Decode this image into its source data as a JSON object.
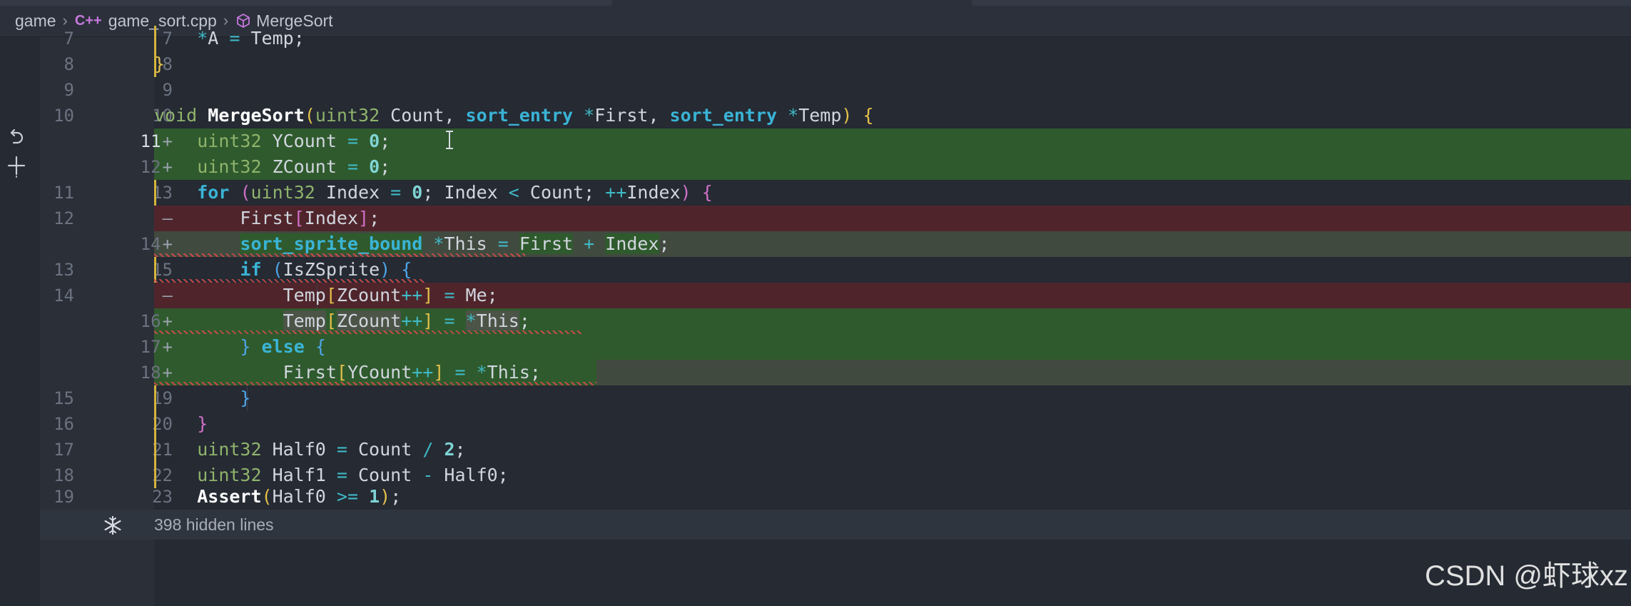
{
  "breadcrumb": {
    "folder": "game",
    "file_icon": "C++",
    "file": "game_sort.cpp",
    "symbol": "MergeSort"
  },
  "editor": {
    "hidden_lines_label": "398 hidden lines",
    "diff_colors": {
      "added": "#2f5a2d",
      "removed": "#4f252b",
      "modified": "#414a3f",
      "edit_bar": "#d4b43c"
    }
  },
  "watermark": "CSDN @虾球xz",
  "lines": [
    {
      "old": "7",
      "new": "7",
      "mark": "",
      "code": "    *A = Temp;"
    },
    {
      "old": "8",
      "new": "8",
      "mark": "",
      "code": "}"
    },
    {
      "old": "9",
      "new": "9",
      "mark": "",
      "code": ""
    },
    {
      "old": "10",
      "new": "10",
      "mark": "",
      "code": "void MergeSort(uint32 Count, sort_entry *First, sort_entry *Temp) {"
    },
    {
      "old": "",
      "new": "11",
      "mark": "+",
      "code": "    uint32 YCount = 0;"
    },
    {
      "old": "",
      "new": "12",
      "mark": "+",
      "code": "    uint32 ZCount = 0;"
    },
    {
      "old": "11",
      "new": "13",
      "mark": "",
      "code": "    for (uint32 Index = 0; Index < Count; ++Index) {"
    },
    {
      "old": "12",
      "new": "",
      "mark": "—",
      "code": "        First[Index];"
    },
    {
      "old": "",
      "new": "14",
      "mark": "+",
      "code": "        sort_sprite_bound *This = First + Index;"
    },
    {
      "old": "13",
      "new": "15",
      "mark": "",
      "code": "        if (IsZSprite) {"
    },
    {
      "old": "14",
      "new": "",
      "mark": "—",
      "code": "            Temp[ZCount++] = Me;"
    },
    {
      "old": "",
      "new": "16",
      "mark": "+",
      "code": "            Temp[ZCount++] = *This;"
    },
    {
      "old": "",
      "new": "17",
      "mark": "+",
      "code": "        } else {"
    },
    {
      "old": "",
      "new": "18",
      "mark": "+",
      "code": "            First[YCount++] = *This;"
    },
    {
      "old": "15",
      "new": "19",
      "mark": "",
      "code": "        }"
    },
    {
      "old": "16",
      "new": "20",
      "mark": "",
      "code": "    }"
    },
    {
      "old": "17",
      "new": "21",
      "mark": "",
      "code": "    uint32 Half0 = Count / 2;"
    },
    {
      "old": "18",
      "new": "22",
      "mark": "",
      "code": "    uint32 Half1 = Count - Half0;"
    },
    {
      "old": "19",
      "new": "23",
      "mark": "",
      "code": "    Assert(Half0 >= 1);"
    }
  ]
}
